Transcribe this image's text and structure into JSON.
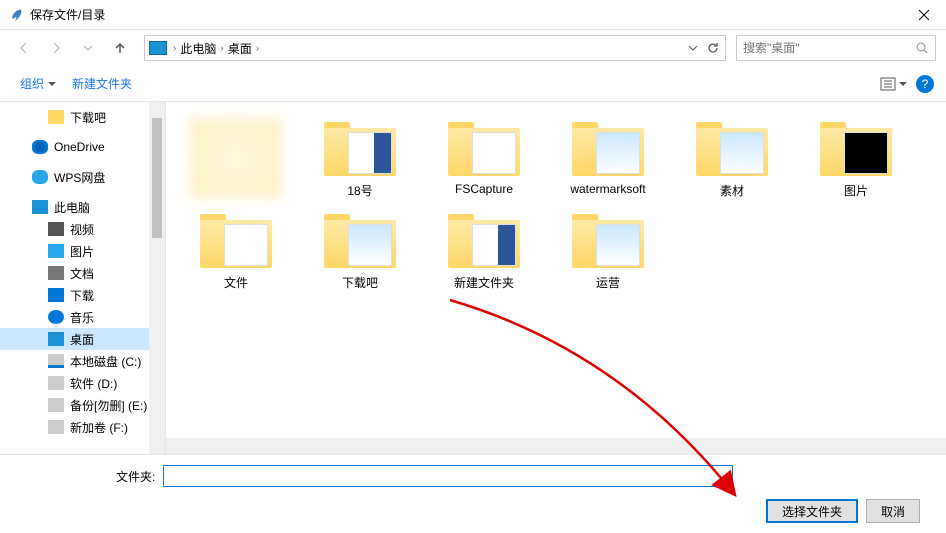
{
  "window": {
    "title": "保存文件/目录"
  },
  "nav": {
    "crumbs": [
      "此电脑",
      "桌面"
    ],
    "search_placeholder": "搜索\"桌面\""
  },
  "toolbar": {
    "organize": "组织",
    "new_folder": "新建文件夹"
  },
  "sidebar": {
    "items": [
      {
        "label": "下载吧",
        "icon": "ic-folder",
        "level": 1
      },
      {
        "label": "OneDrive",
        "icon": "ic-onedrive",
        "level": 0
      },
      {
        "label": "WPS网盘",
        "icon": "ic-wps",
        "level": 0
      },
      {
        "label": "此电脑",
        "icon": "ic-pc",
        "level": 0
      },
      {
        "label": "视频",
        "icon": "ic-video",
        "level": 1
      },
      {
        "label": "图片",
        "icon": "ic-pic",
        "level": 1
      },
      {
        "label": "文档",
        "icon": "ic-doc",
        "level": 1
      },
      {
        "label": "下载",
        "icon": "ic-down",
        "level": 1
      },
      {
        "label": "音乐",
        "icon": "ic-music",
        "level": 1
      },
      {
        "label": "桌面",
        "icon": "ic-desk",
        "level": 1,
        "selected": true
      },
      {
        "label": "本地磁盘 (C:)",
        "icon": "ic-drive",
        "level": 1
      },
      {
        "label": "软件 (D:)",
        "icon": "ic-drive2",
        "level": 1
      },
      {
        "label": "备份[勿删] (E:)",
        "icon": "ic-drive2",
        "level": 1
      },
      {
        "label": "新加卷 (F:)",
        "icon": "ic-drive2",
        "level": 1
      }
    ]
  },
  "content": {
    "items": [
      {
        "label": "",
        "type": "blur"
      },
      {
        "label": "18号",
        "inner": "doc"
      },
      {
        "label": "FSCapture",
        "inner": "fs"
      },
      {
        "label": "watermarksoft",
        "inner": "pics"
      },
      {
        "label": "素材",
        "inner": "pics"
      },
      {
        "label": "图片",
        "inner": "tiktok"
      },
      {
        "label": "文件",
        "inner": "plain"
      },
      {
        "label": "下载吧",
        "inner": "pics"
      },
      {
        "label": "新建文件夹",
        "inner": "doc"
      },
      {
        "label": "运营",
        "inner": "pics"
      }
    ]
  },
  "footer": {
    "folder_label": "文件夹:",
    "folder_value": "",
    "select_button": "选择文件夹",
    "cancel_button": "取消"
  }
}
